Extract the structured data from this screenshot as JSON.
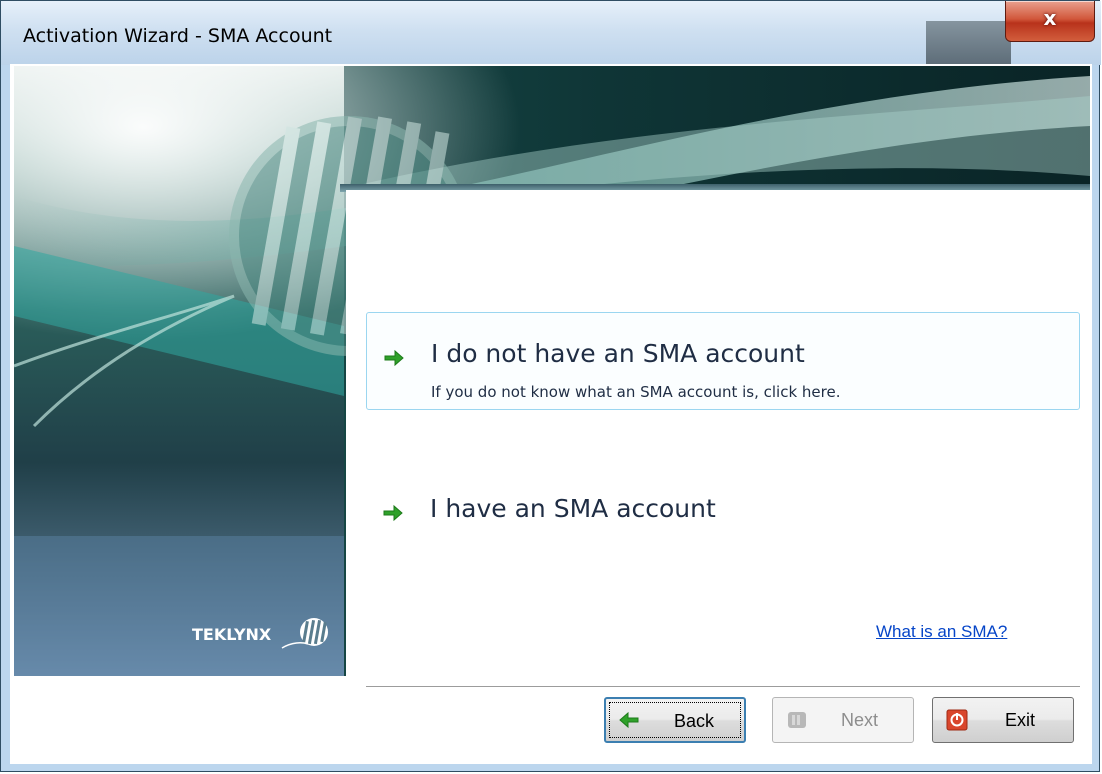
{
  "window": {
    "title": "Activation Wizard - SMA Account",
    "close_glyph": "x"
  },
  "options": [
    {
      "title": "I do not have an SMA account",
      "subtitle": "If you do not know what an SMA account is, click here.",
      "icon": "green-arrow-right-icon"
    },
    {
      "title": "I have an SMA account",
      "icon": "green-arrow-right-icon"
    }
  ],
  "help_link": "What is an SMA?",
  "logo": "TEKLYNX",
  "buttons": {
    "back": "Back",
    "next": "Next",
    "exit": "Exit"
  },
  "colors": {
    "accent_green": "#2fa12a",
    "link_blue": "#0645c8",
    "teal_banner": "#2c6e66",
    "close_red": "#c8432a"
  }
}
